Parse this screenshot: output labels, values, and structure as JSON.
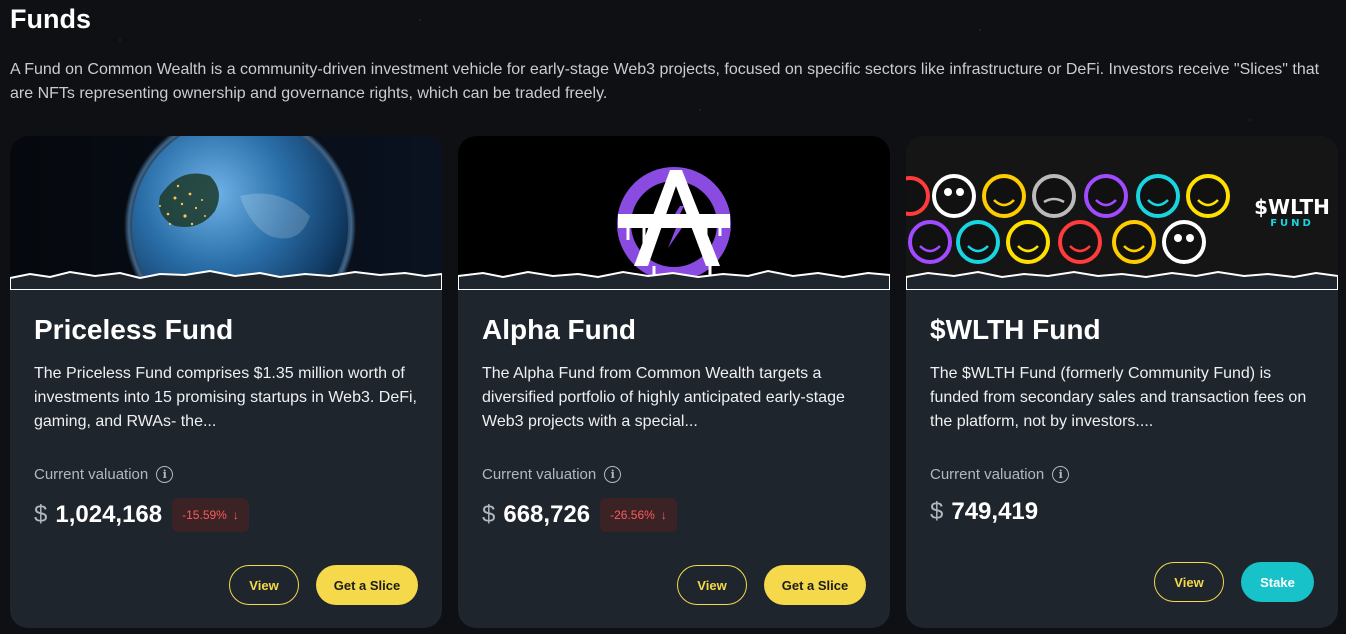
{
  "page": {
    "title": "Funds",
    "description": "A Fund on Common Wealth is a community-driven investment vehicle for early-stage Web3 projects, focused on specific sectors like infrastructure or DeFi. Investors receive \"Slices\" that are NFTs representing ownership and governance rights, which can be traded freely."
  },
  "colors": {
    "background": "#0e1013",
    "card": "#1f252c",
    "accent_yellow": "#f5d94a",
    "accent_teal": "#18c2c9",
    "negative": "#ff5b5b"
  },
  "cards": [
    {
      "title": "Priceless Fund",
      "description": "The Priceless Fund comprises $1.35 million worth of investments into 15 promising startups in Web3. DeFi, gaming, and RWAs- the...",
      "valuation_label": "Current valuation",
      "currency": "$",
      "valuation": "1,024,168",
      "change": "-15.59%",
      "change_icon": "arrow-down-icon",
      "view_label": "View",
      "action_label": "Get a Slice",
      "image": "earth-from-space"
    },
    {
      "title": "Alpha Fund",
      "description": "The Alpha Fund from Common Wealth targets a diversified portfolio of highly anticipated early-stage Web3 projects with a special...",
      "valuation_label": "Current valuation",
      "currency": "$",
      "valuation": "668,726",
      "change": "-26.56%",
      "change_icon": "arrow-down-icon",
      "view_label": "View",
      "action_label": "Get a Slice",
      "image": "anarchy-logo"
    },
    {
      "title": "$WLTH Fund",
      "description": "The $WLTH Fund (formerly Community Fund) is funded from secondary sales and transaction fees on the platform, not by investors....",
      "valuation_label": "Current valuation",
      "currency": "$",
      "valuation": "749,419",
      "view_label": "View",
      "action_label": "Stake",
      "image": "neon-smiley-faces",
      "banner_logo_line1": "$WLTH",
      "banner_logo_line2": "FUND"
    }
  ]
}
